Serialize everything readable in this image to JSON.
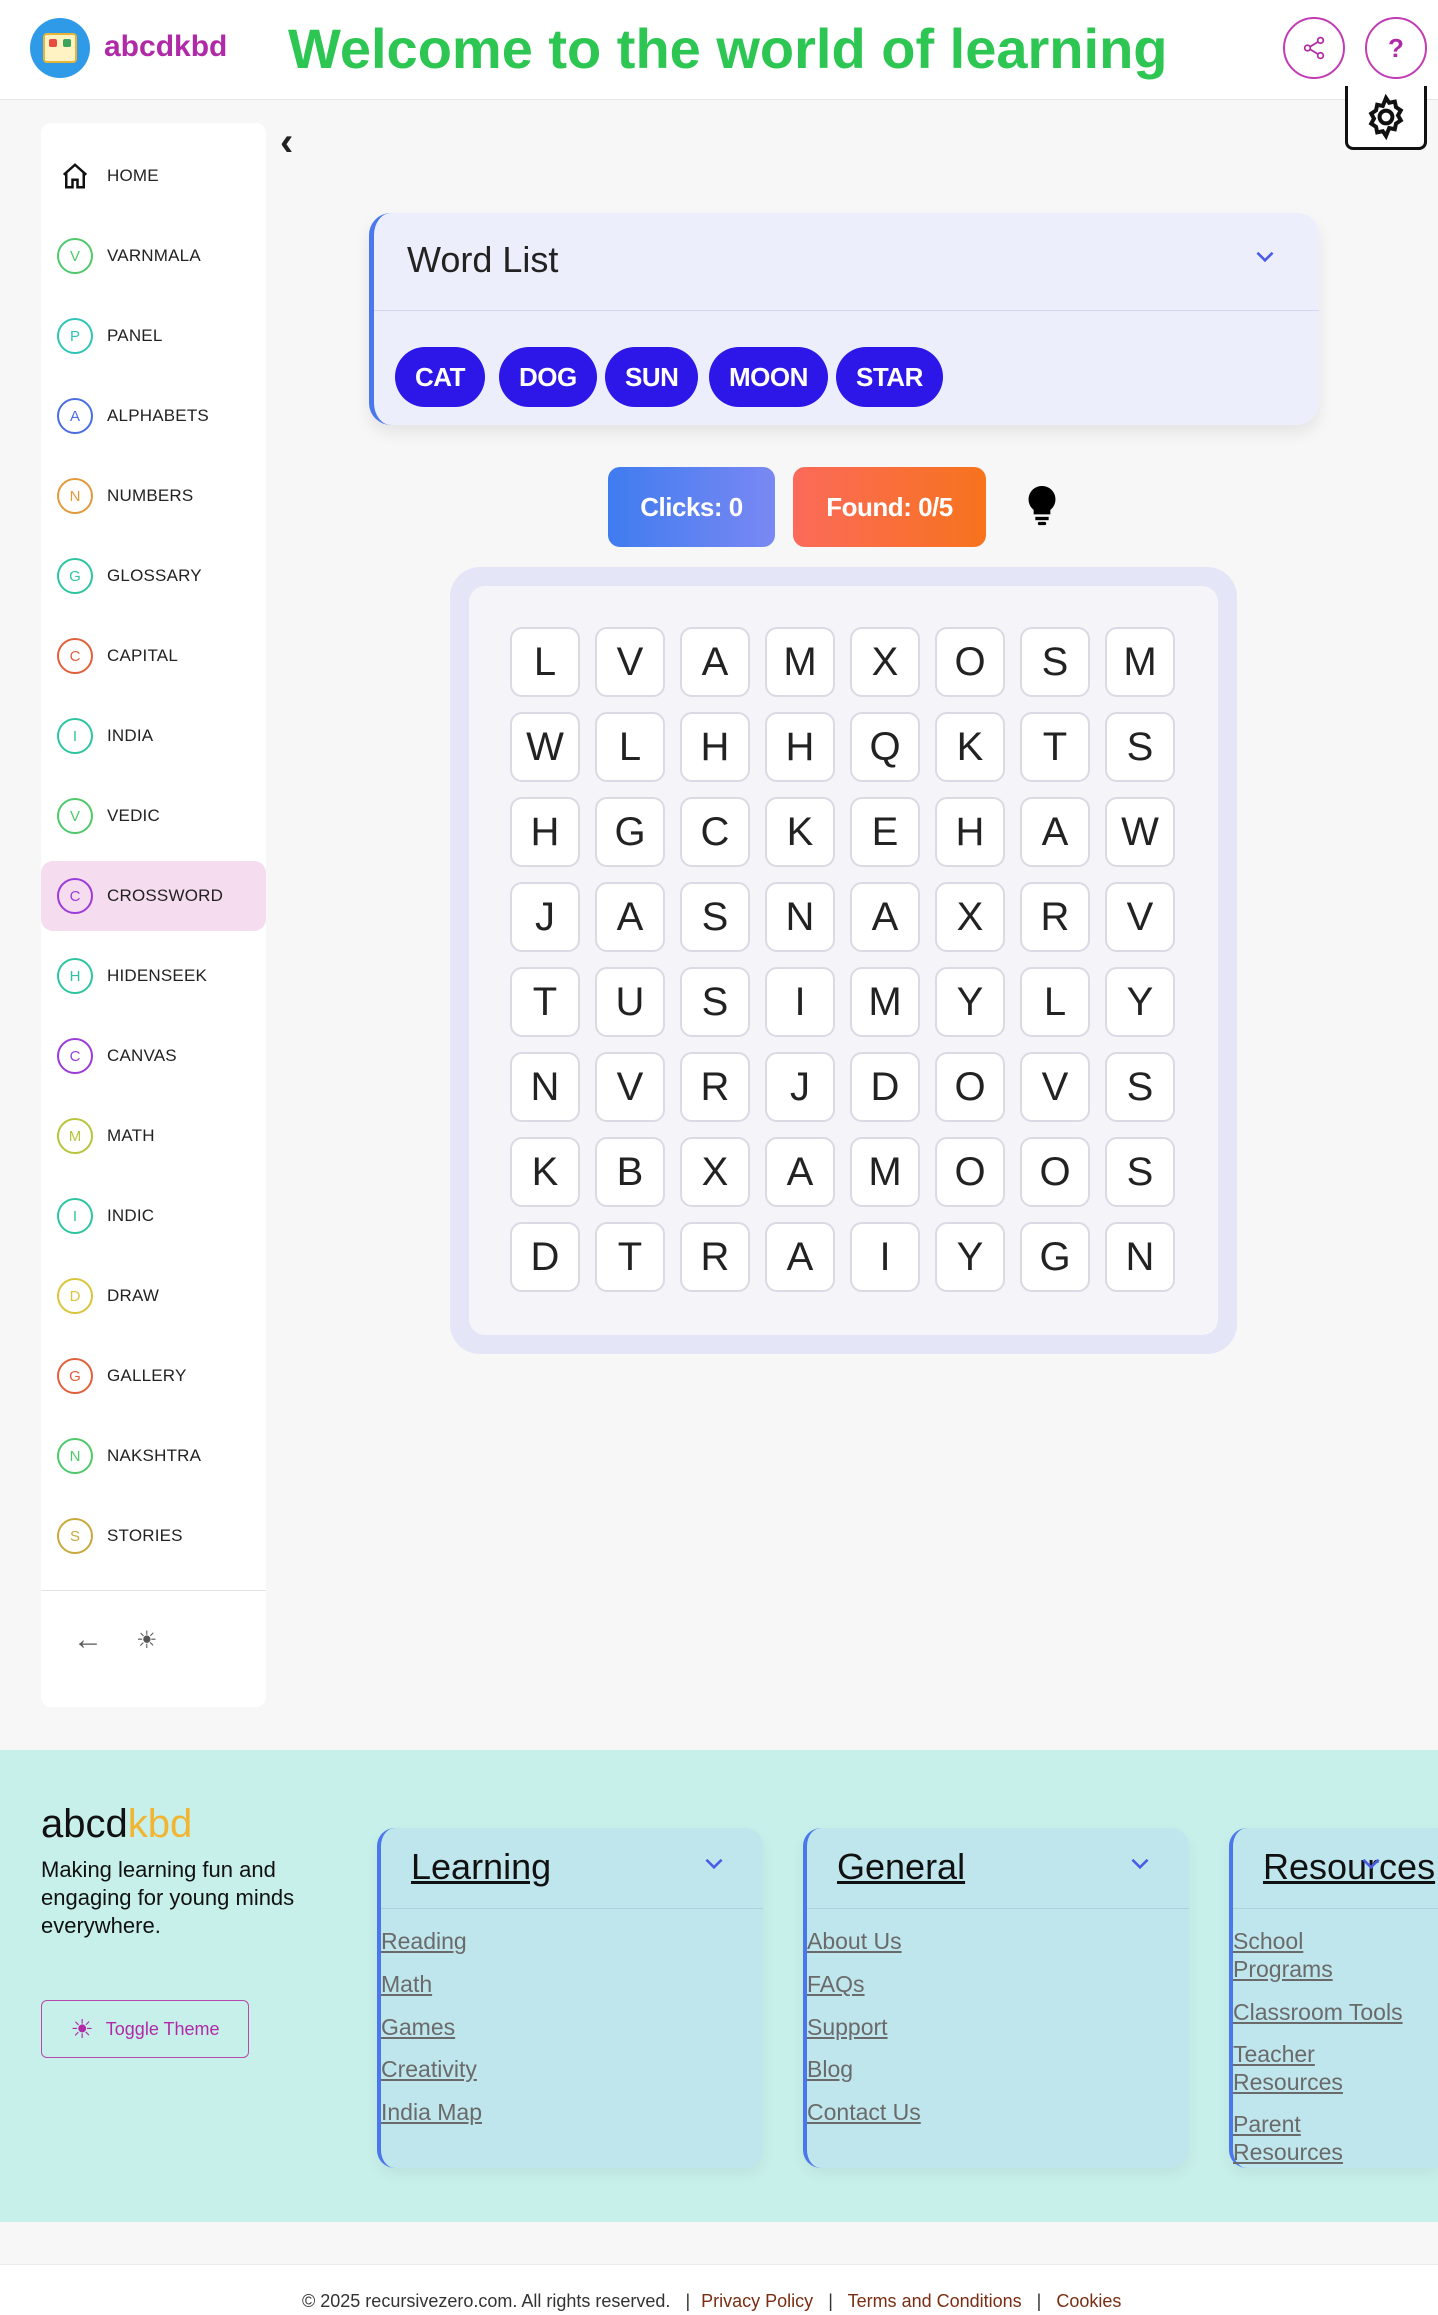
{
  "header": {
    "brand": "abcdkbd",
    "welcome": "Welcome to the world of learning",
    "share_icon": "share-icon",
    "help_label": "?",
    "settings_icon": "gear-icon"
  },
  "sidebar": {
    "items": [
      {
        "label": "HOME",
        "letter": "",
        "color": "#111111",
        "icon": "home-icon"
      },
      {
        "label": "VARNMALA",
        "letter": "V",
        "color": "#4fc96b"
      },
      {
        "label": "PANEL",
        "letter": "P",
        "color": "#2ec4b6"
      },
      {
        "label": "ALPHABETS",
        "letter": "A",
        "color": "#4a6ee0"
      },
      {
        "label": "NUMBERS",
        "letter": "N",
        "color": "#e39a3c"
      },
      {
        "label": "GLOSSARY",
        "letter": "G",
        "color": "#2ec4a0"
      },
      {
        "label": "CAPITAL",
        "letter": "C",
        "color": "#e0603c"
      },
      {
        "label": "INDIA",
        "letter": "I",
        "color": "#2ec4a0"
      },
      {
        "label": "VEDIC",
        "letter": "V",
        "color": "#4fc96b"
      },
      {
        "label": "CROSSWORD",
        "letter": "C",
        "color": "#9b3cd9",
        "active": true
      },
      {
        "label": "HIDENSEEK",
        "letter": "H",
        "color": "#2ec4a0"
      },
      {
        "label": "CANVAS",
        "letter": "C",
        "color": "#9b3cd9"
      },
      {
        "label": "MATH",
        "letter": "M",
        "color": "#b8c43c"
      },
      {
        "label": "INDIC",
        "letter": "I",
        "color": "#2ec4a0"
      },
      {
        "label": "DRAW",
        "letter": "D",
        "color": "#d9c43c"
      },
      {
        "label": "GALLERY",
        "letter": "G",
        "color": "#e0603c"
      },
      {
        "label": "NAKSHTRA",
        "letter": "N",
        "color": "#4fc96b"
      },
      {
        "label": "STORIES",
        "letter": "S",
        "color": "#c9a83c"
      }
    ],
    "collapse_icon": "arrow-left-icon",
    "theme_icon": "sun-icon"
  },
  "wordlist": {
    "title": "Word List",
    "words": [
      "CAT",
      "DOG",
      "SUN",
      "MOON",
      "STAR"
    ]
  },
  "stats": {
    "clicks": "Clicks: 0",
    "found": "Found: 0/5",
    "hint_icon": "lightbulb-icon"
  },
  "grid": [
    [
      "L",
      "V",
      "A",
      "M",
      "X",
      "O",
      "S",
      "M"
    ],
    [
      "W",
      "L",
      "H",
      "H",
      "Q",
      "K",
      "T",
      "S"
    ],
    [
      "H",
      "G",
      "C",
      "K",
      "E",
      "H",
      "A",
      "W"
    ],
    [
      "J",
      "A",
      "S",
      "N",
      "A",
      "X",
      "R",
      "V"
    ],
    [
      "T",
      "U",
      "S",
      "I",
      "M",
      "Y",
      "L",
      "Y"
    ],
    [
      "N",
      "V",
      "R",
      "J",
      "D",
      "O",
      "V",
      "S"
    ],
    [
      "K",
      "B",
      "X",
      "A",
      "M",
      "O",
      "O",
      "S"
    ],
    [
      "D",
      "T",
      "R",
      "A",
      "I",
      "Y",
      "G",
      "N"
    ]
  ],
  "footer": {
    "brand_a": "abcd",
    "brand_b": "kbd",
    "tagline": "Making learning fun and engaging for young minds everywhere.",
    "toggle_theme": "Toggle Theme",
    "sections": [
      {
        "title": "Learning",
        "links": [
          "Reading",
          "Math",
          "Games",
          "Creativity",
          "India Map"
        ]
      },
      {
        "title": "General",
        "links": [
          "About Us",
          "FAQs",
          "Support",
          "Blog",
          "Contact Us"
        ]
      },
      {
        "title": "Resources",
        "links": [
          "School Programs",
          "Classroom Tools",
          "Teacher Resources",
          "Parent Resources"
        ]
      }
    ],
    "copyright": "© 2025 recursivezero.com. All rights reserved.",
    "legal": [
      "Privacy Policy",
      "Terms and Conditions",
      "Cookies"
    ],
    "separator": "|"
  }
}
